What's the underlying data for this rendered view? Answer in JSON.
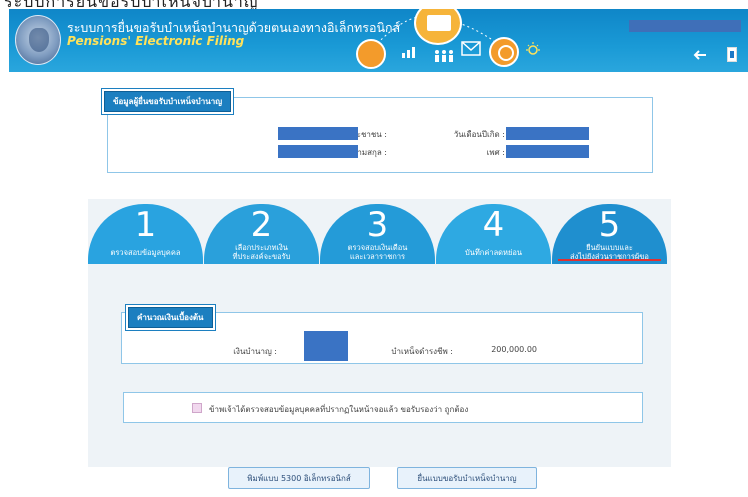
{
  "page_caption": "ระบบการยื่นขอรับบำเหน็จบำนาญ",
  "header": {
    "title_th": "ระบบการยื่นขอรับบำเหน็จบำนาญด้วยตนเองทางอิเล็กทรอนิกส์",
    "title_en": "Pensions' Electronic Filing"
  },
  "applicant": {
    "title": "ข้อมูลผู้ยื่นขอรับบำเหน็จบำนาญ",
    "fields": {
      "citizen_id": "เลขบัตรประชาชน :",
      "birth_date": "วันเดือนปีเกิด :",
      "name": "ชื่อ - นามสกุล :",
      "gender": "เพศ :"
    }
  },
  "steps": [
    {
      "num": "1",
      "label": "ตรวจสอบข้อมูลบุคคล"
    },
    {
      "num": "2",
      "label_line1": "เลือกประเภทเงิน",
      "label_line2": "ที่ประสงค์จะขอรับ"
    },
    {
      "num": "3",
      "label_line1": "ตรวจสอบเงินเดือน",
      "label_line2": "และเวลาราชการ"
    },
    {
      "num": "4",
      "label": "บันทึกค่าลดหย่อน"
    },
    {
      "num": "5",
      "label_line1": "ยืนยันแบบและ",
      "label_line2": "ส่งไปยังส่วนราชการผู้ขอ"
    }
  ],
  "calculation": {
    "title": "คำนวณเงินเบื้องต้น",
    "pension_label": "เงินบำนาญ :",
    "lump_sum_label": "บำเหน็จดำรงชีพ :",
    "lump_sum_value": "200,000.00"
  },
  "consent": {
    "text": "ข้าพเจ้าได้ตรวจสอบข้อมูลบุคคลที่ปรากฏในหน้าจอแล้ว ขอรับรองว่า ถูกต้อง"
  },
  "buttons": {
    "print": "พิมพ์แบบ 5300 อิเล็กทรอนิกส์",
    "submit": "ยื่นแบบขอรับบำเหน็จบำนาญ"
  },
  "colors": {
    "header_blue": "#1a9ad6",
    "step_blue": "#29a3e0",
    "redaction": "#3a73c4",
    "active_underline": "#e03030"
  }
}
